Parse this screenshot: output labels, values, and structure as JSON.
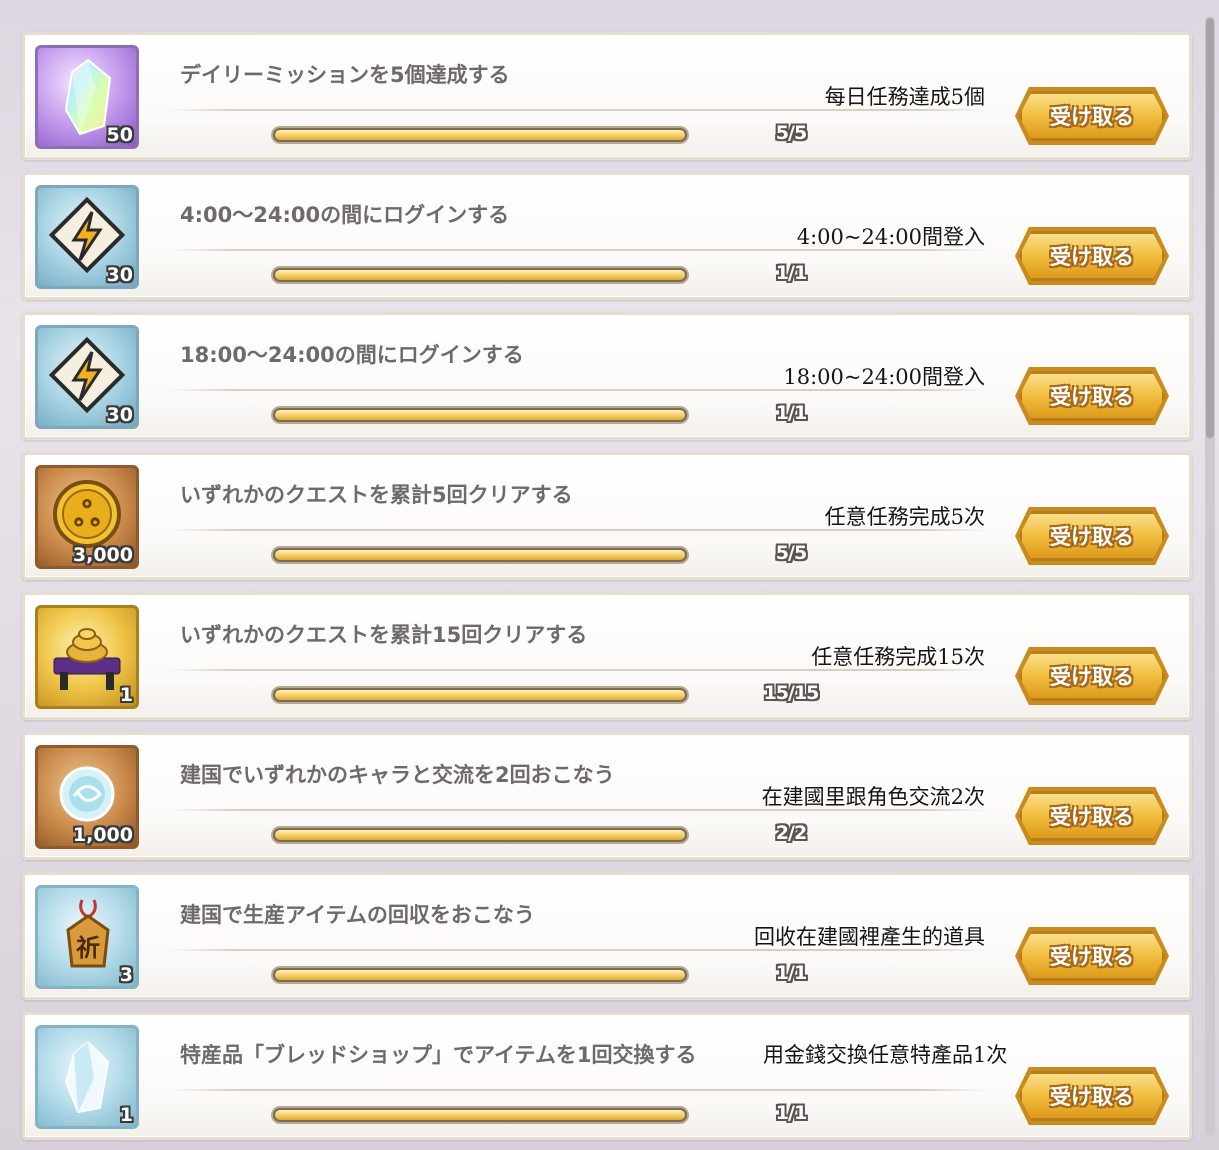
{
  "missions": [
    {
      "icon": "rainbow-crystal-icon",
      "icon_bg": "purple",
      "qty": "50",
      "title": "デイリーミッションを5個達成する",
      "translation": "每日任務達成5個",
      "progress": 1.0,
      "count": "5/5",
      "button": "受け取る"
    },
    {
      "icon": "stamina-bolt-icon",
      "icon_bg": "teal",
      "qty": "30",
      "title": "4:00〜24:00の間にログインする",
      "translation": "4:00~24:00間登入",
      "progress": 1.0,
      "count": "1/1",
      "button": "受け取る"
    },
    {
      "icon": "stamina-bolt-icon",
      "icon_bg": "teal",
      "qty": "30",
      "title": "18:00〜24:00の間にログインする",
      "translation": "18:00~24:00間登入",
      "progress": 1.0,
      "count": "1/1",
      "button": "受け取る"
    },
    {
      "icon": "gold-coin-icon",
      "icon_bg": "bronze",
      "qty": "3,000",
      "title": "いずれかのクエストを累計5回クリアする",
      "translation": "任意任務完成5次",
      "progress": 1.0,
      "count": "5/5",
      "button": "受け取る"
    },
    {
      "icon": "coin-pile-table-icon",
      "icon_bg": "gold",
      "qty": "1",
      "title": "いずれかのクエストを累計15回クリアする",
      "translation": "任意任務完成15次",
      "progress": 1.0,
      "count": "15/15",
      "button": "受け取る"
    },
    {
      "icon": "spirit-orb-icon",
      "icon_bg": "bronze",
      "qty": "1,000",
      "title": "建国でいずれかのキャラと交流を2回おこなう",
      "translation": "在建國里跟角色交流2次",
      "progress": 1.0,
      "count": "2/2",
      "button": "受け取る"
    },
    {
      "icon": "charm-amulet-icon",
      "icon_bg": "ice",
      "qty": "3",
      "title": "建国で生産アイテムの回収をおこなう",
      "translation": "回收在建國裡產生的道具",
      "progress": 1.0,
      "count": "1/1",
      "button": "受け取る"
    },
    {
      "icon": "ice-crystal-icon",
      "icon_bg": "ice",
      "qty": "1",
      "title": "特産品「ブレッドショップ」でアイテムを1回交換する",
      "translation": "用金錢交換任意特產品1次",
      "progress": 1.0,
      "count": "1/1",
      "button": "受け取る"
    }
  ]
}
